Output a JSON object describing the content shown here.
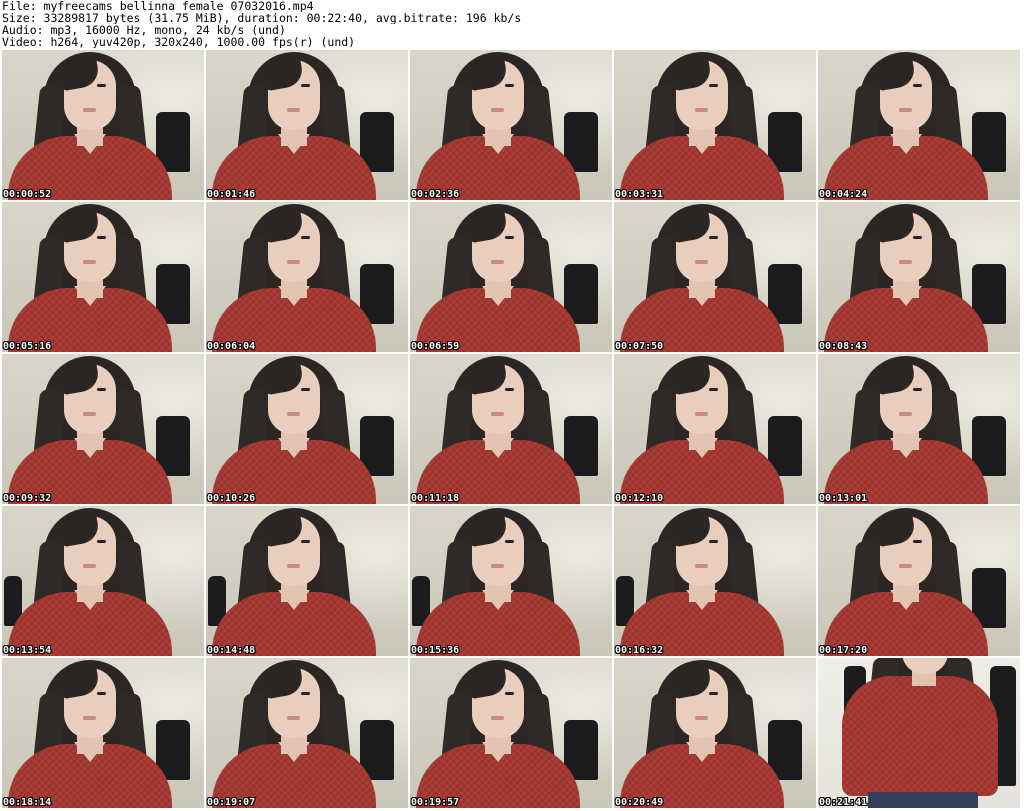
{
  "header": {
    "file_line": "File: myfreecams_bellinna_female_07032016.mp4",
    "size_line": "Size: 33289817 bytes (31.75 MiB), duration: 00:22:40, avg.bitrate: 196 kb/s",
    "audio_line": "Audio: mp3, 16000 Hz, mono, 24 kb/s (und)",
    "video_line": "Video: h264, yuv420p, 320x240, 1000.00 fps(r) (und)"
  },
  "thumbnails": [
    {
      "timestamp": "00:00:52"
    },
    {
      "timestamp": "00:01:46"
    },
    {
      "timestamp": "00:02:36"
    },
    {
      "timestamp": "00:03:31"
    },
    {
      "timestamp": "00:04:24"
    },
    {
      "timestamp": "00:05:16"
    },
    {
      "timestamp": "00:06:04"
    },
    {
      "timestamp": "00:06:59"
    },
    {
      "timestamp": "00:07:50"
    },
    {
      "timestamp": "00:08:43"
    },
    {
      "timestamp": "00:09:32"
    },
    {
      "timestamp": "00:10:26"
    },
    {
      "timestamp": "00:11:18"
    },
    {
      "timestamp": "00:12:10"
    },
    {
      "timestamp": "00:13:01"
    },
    {
      "timestamp": "00:13:54"
    },
    {
      "timestamp": "00:14:48"
    },
    {
      "timestamp": "00:15:36"
    },
    {
      "timestamp": "00:16:32"
    },
    {
      "timestamp": "00:17:20"
    },
    {
      "timestamp": "00:18:14"
    },
    {
      "timestamp": "00:19:07"
    },
    {
      "timestamp": "00:19:57"
    },
    {
      "timestamp": "00:20:49"
    },
    {
      "timestamp": "00:21:41"
    }
  ],
  "colors": {
    "background": "#ffffff",
    "header_text": "#000000",
    "timestamp_text": "#ffffff",
    "timestamp_outline": "#000000",
    "sweater": "#a53630",
    "hair": "#2b2624",
    "chair": "#1c1c1e"
  }
}
